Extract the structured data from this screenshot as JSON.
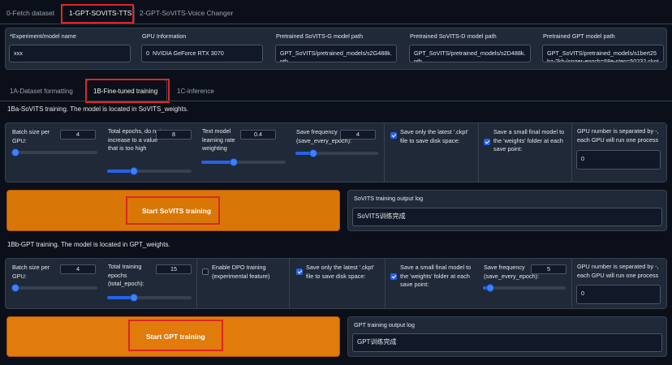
{
  "top_tabs": [
    "0-Fetch dataset",
    "1-GPT-SOVITS-TTS",
    "2-GPT-SoVITS-Voice Changer"
  ],
  "config": {
    "experiment_label": "*Experiment/model name",
    "experiment_value": "xxx",
    "gpu_label": "GPU Information",
    "gpu_value": "0  NVIDIA GeForce RTX 3070",
    "sovits_g_label": "Pretrained SoVITS-G model path",
    "sovits_g_value": "GPT_SoVITS/pretrained_models/s2G488k.pth",
    "sovits_d_label": "Pretrained SoVITS-D model path",
    "sovits_d_value": "GPT_SoVITS/pretrained_models/s2D488k.pth",
    "gpt_label": "Pretrained GPT model path",
    "gpt_value": "GPT_SoVITS/pretrained_models/s1bert25hz-2kh-longer-epoch=68e-step=50232.ckpt"
  },
  "sub_tabs": [
    "1A-Dataset formatting",
    "1B-Fine-tuned training",
    "1C-inference"
  ],
  "sovits": {
    "title": "1Ba-SoVITS training. The model is located in SoVITS_weights.",
    "batch_label": "Batch size per GPU:",
    "batch_value": "4",
    "epochs_label": "Total epochs, do not increase to a value that is too high",
    "epochs_value": "8",
    "lr_label": "Text model learning rate weighting",
    "lr_value": "0.4",
    "save_freq_label": "Save frequency (save_every_epoch):",
    "save_freq_value": "4",
    "save_latest_label": "Save only the latest '.ckpt' file to save disk space:",
    "save_final_label": "Save a small final model to the 'weights' folder at each save point:",
    "gpu_num_label": "GPU number is separated by -, each GPU will run one process",
    "gpu_num_value": "0",
    "start_button": "Start SoVITS training",
    "log_label": "SoVITS training output log",
    "log_value": "SoVITS训练完成"
  },
  "gpt": {
    "title": "1Bb-GPT training. The model is located in GPT_weights.",
    "batch_label": "Batch size per GPU:",
    "batch_value": "4",
    "epochs_label": "Total training epochs (total_epoch):",
    "epochs_value": "15",
    "dpo_label": "Enable DPO training (experimental feature)",
    "save_latest_label": "Save only the latest '.ckpt' file to save disk space:",
    "save_final_label": "Save a small final model to the 'weights' folder at each save point:",
    "save_freq_label": "Save frequency (save_every_epoch):",
    "save_freq_value": "5",
    "gpu_num_label": "GPU number is separated by -, each GPU will run one process",
    "gpu_num_value": "0",
    "start_button": "Start GPT training",
    "log_label": "GPT training output log",
    "log_value": "GPT训练完成"
  },
  "colors": {
    "accent": "#2563eb",
    "button_orange": "#d97706",
    "highlight_red": "#dc2626",
    "background": "#0b0f19"
  }
}
